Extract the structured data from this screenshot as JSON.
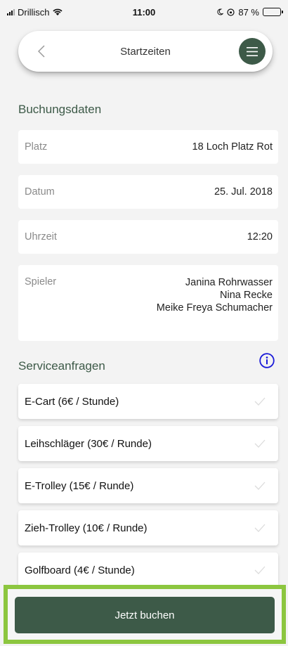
{
  "status_bar": {
    "carrier": "Drillisch",
    "time": "11:00",
    "battery": "87 %",
    "battery_level": 0.87
  },
  "nav": {
    "title": "Startzeiten",
    "back_icon": "chevron-left-icon",
    "menu_icon": "hamburger-menu-icon"
  },
  "booking": {
    "section_title": "Buchungsdaten",
    "platz_label": "Platz",
    "platz_value": "18 Loch Platz Rot",
    "datum_label": "Datum",
    "datum_value": "25. Jul. 2018",
    "uhrzeit_label": "Uhrzeit",
    "uhrzeit_value": "12:20",
    "spieler_label": "Spieler",
    "spieler": [
      "Janina Rohrwasser",
      "Nina Recke",
      "Meike Freya Schumacher"
    ]
  },
  "services": {
    "section_title": "Serviceanfragen",
    "items": [
      {
        "label": "E-Cart (6€ / Stunde)"
      },
      {
        "label": "Leihschläger (30€ / Runde)"
      },
      {
        "label": "E-Trolley (15€ / Runde)"
      },
      {
        "label": "Zieh-Trolley (10€ / Runde)"
      },
      {
        "label": "Golfboard (4€ / Stunde)"
      }
    ]
  },
  "cta": {
    "label": "Jetzt buchen"
  },
  "colors": {
    "brand_green": "#3d5a48",
    "highlight_green": "#8cc63f",
    "info_blue": "#1a1ad8",
    "background": "#f3f3f3"
  }
}
